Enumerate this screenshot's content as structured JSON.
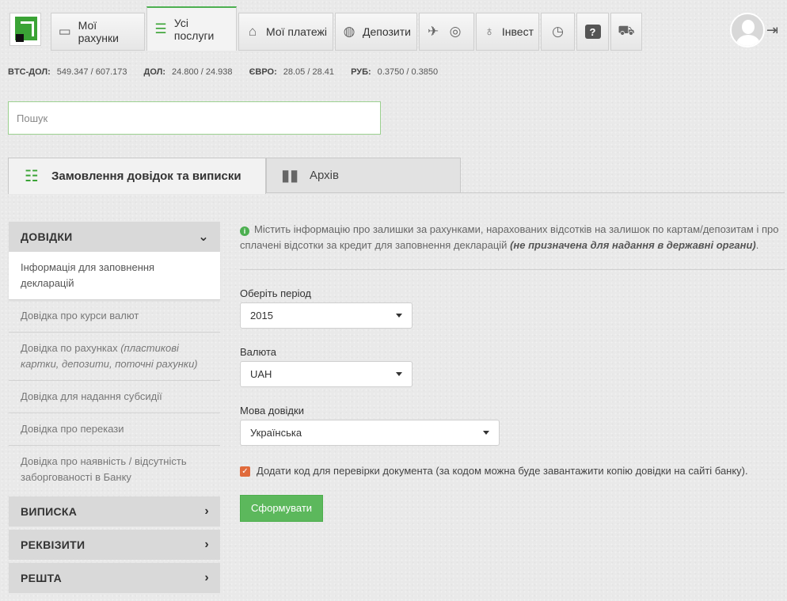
{
  "nav": {
    "tabs": [
      {
        "label": "Мої рахунки",
        "icon": "card-icon"
      },
      {
        "label": "Усі послуги",
        "icon": "list-icon"
      },
      {
        "label": "Мої платежі",
        "icon": "house-icon"
      },
      {
        "label": "Депозити",
        "icon": "piggy-bank-icon"
      },
      {
        "label": "",
        "icon": "transport-icon"
      },
      {
        "label": "Інвест",
        "icon": "money-bag-icon"
      },
      {
        "label": "",
        "icon": "clock-icon"
      },
      {
        "label": "",
        "icon": "help-icon"
      },
      {
        "label": "",
        "icon": "cart-icon"
      }
    ]
  },
  "rates": [
    {
      "name": "BTC-ДОЛ:",
      "value": "549.347 / 607.173"
    },
    {
      "name": "ДОЛ:",
      "value": "24.800 / 24.938"
    },
    {
      "name": "ЄВРО:",
      "value": "28.05 / 28.41"
    },
    {
      "name": "РУБ:",
      "value": "0.3750 / 0.3850"
    }
  ],
  "search": {
    "placeholder": "Пошук"
  },
  "page_tabs": {
    "active": "Замовлення довідок та виписки",
    "inactive": "Архів"
  },
  "menu": {
    "sections": [
      {
        "title": "ДОВІДКИ"
      },
      {
        "title": "ВИПИСКА"
      },
      {
        "title": "РЕКВІЗИТИ"
      },
      {
        "title": "РЕШТА"
      }
    ],
    "items": [
      {
        "text": "Інформація для заповнення декларацій",
        "note": ""
      },
      {
        "text": "Довідка про курси валют",
        "note": ""
      },
      {
        "text": "Довідка по рахунках ",
        "note": "(пластикові картки, депозити, поточні рахунки)"
      },
      {
        "text": "Довідка для надання субсидії",
        "note": ""
      },
      {
        "text": "Довідка про перекази",
        "note": ""
      },
      {
        "text": "Довідка про наявність / відсутність заборгованості в Банку",
        "note": ""
      }
    ]
  },
  "content": {
    "info_text": "Містить інформацію про залишки за рахунками, нарахованих відсотків на залишок по картам/депозитам і про сплачені відсотки за кредит для заповнення декларацій ",
    "info_bold": "(не призначена для надання в державні органи)",
    "info_end": ".",
    "period_label": "Оберіть період",
    "period_value": "2015",
    "currency_label": "Валюта",
    "currency_value": "UAH",
    "language_label": "Мова довідки",
    "language_value": "Українська",
    "checkbox_label": "Додати код для перевірки документа (за кодом можна буде завантажити копію довідки на сайті банку).",
    "submit": "Сформувати"
  }
}
